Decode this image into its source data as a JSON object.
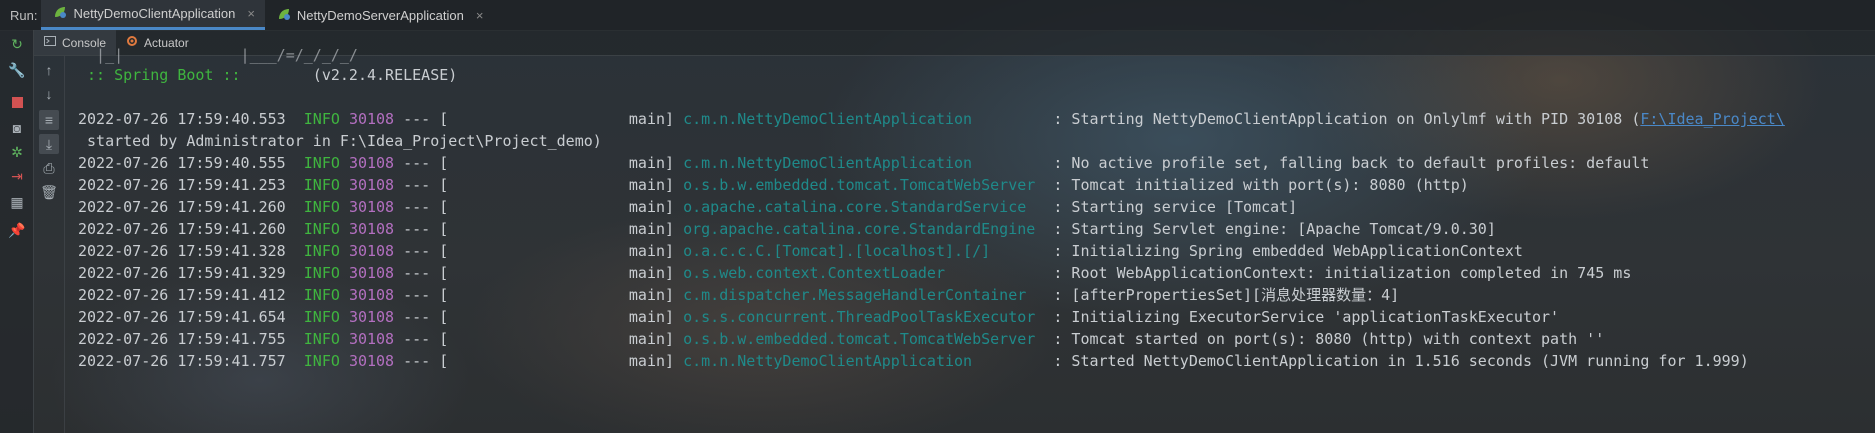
{
  "run_bar": {
    "label": "Run:",
    "tabs": [
      {
        "label": "NettyDemoClientApplication",
        "active": true
      },
      {
        "label": "NettyDemoServerApplication",
        "active": false
      }
    ],
    "close_glyph": "×"
  },
  "sub_tabs": [
    {
      "label": "Console",
      "icon": "console-icon",
      "active": true
    },
    {
      "label": "Actuator",
      "icon": "actuator-icon",
      "active": false
    }
  ],
  "toolbar_icons": {
    "left": [
      "rerun-icon",
      "settings-wrench-icon",
      "stop-icon",
      "camera-icon",
      "debug-icon",
      "exit-icon",
      "layout-icon",
      "pin-icon"
    ],
    "right": [
      "arrow-up-icon",
      "arrow-down-icon",
      "soft-wrap-icon",
      "scroll-to-end-icon",
      "print-icon",
      "trash-icon"
    ]
  },
  "colors": {
    "info": "#3fb53f",
    "pid": "#b36fc0",
    "logger": "#1f8a8a",
    "link": "#4a88c7",
    "text": "#c9cdd1"
  },
  "console": {
    "banner_cut": "  |_|             |___/=/_/_/_/",
    "spring_label": " :: Spring Boot ::",
    "spring_version": "        (v2.2.4.RELEASE)",
    "started_pid_msg": ": Starting NettyDemoClientApplication on Onlylmf with PID 30108 (",
    "started_link": "F:\\Idea_Project\\",
    "continuation": " started by Administrator in F:\\Idea_Project\\Project_demo)",
    "logs": [
      {
        "ts": "2022-07-26 17:59:40.553",
        "level": "INFO",
        "pid": "30108",
        "sep": "--- [",
        "thread": "main]",
        "logger": "c.m.n.NettyDemoClientApplication",
        "msg": ": Starting NettyDemoClientApplication on Onlylmf with PID 30108 (",
        "link": "F:\\Idea_Project\\"
      },
      {
        "ts": "2022-07-26 17:59:40.555",
        "level": "INFO",
        "pid": "30108",
        "sep": "--- [",
        "thread": "main]",
        "logger": "c.m.n.NettyDemoClientApplication",
        "msg": ": No active profile set, falling back to default profiles: default"
      },
      {
        "ts": "2022-07-26 17:59:41.253",
        "level": "INFO",
        "pid": "30108",
        "sep": "--- [",
        "thread": "main]",
        "logger": "o.s.b.w.embedded.tomcat.TomcatWebServer",
        "msg": ": Tomcat initialized with port(s): 8080 (http)"
      },
      {
        "ts": "2022-07-26 17:59:41.260",
        "level": "INFO",
        "pid": "30108",
        "sep": "--- [",
        "thread": "main]",
        "logger": "o.apache.catalina.core.StandardService",
        "msg": ": Starting service [Tomcat]"
      },
      {
        "ts": "2022-07-26 17:59:41.260",
        "level": "INFO",
        "pid": "30108",
        "sep": "--- [",
        "thread": "main]",
        "logger": "org.apache.catalina.core.StandardEngine",
        "msg": ": Starting Servlet engine: [Apache Tomcat/9.0.30]"
      },
      {
        "ts": "2022-07-26 17:59:41.328",
        "level": "INFO",
        "pid": "30108",
        "sep": "--- [",
        "thread": "main]",
        "logger": "o.a.c.c.C.[Tomcat].[localhost].[/]",
        "msg": ": Initializing Spring embedded WebApplicationContext"
      },
      {
        "ts": "2022-07-26 17:59:41.329",
        "level": "INFO",
        "pid": "30108",
        "sep": "--- [",
        "thread": "main]",
        "logger": "o.s.web.context.ContextLoader",
        "msg": ": Root WebApplicationContext: initialization completed in 745 ms"
      },
      {
        "ts": "2022-07-26 17:59:41.412",
        "level": "INFO",
        "pid": "30108",
        "sep": "--- [",
        "thread": "main]",
        "logger": "c.m.dispatcher.MessageHandlerContainer",
        "msg": ": [afterPropertiesSet][消息处理器数量：4]"
      },
      {
        "ts": "2022-07-26 17:59:41.654",
        "level": "INFO",
        "pid": "30108",
        "sep": "--- [",
        "thread": "main]",
        "logger": "o.s.s.concurrent.ThreadPoolTaskExecutor",
        "msg": ": Initializing ExecutorService 'applicationTaskExecutor'"
      },
      {
        "ts": "2022-07-26 17:59:41.755",
        "level": "INFO",
        "pid": "30108",
        "sep": "--- [",
        "thread": "main]",
        "logger": "o.s.b.w.embedded.tomcat.TomcatWebServer",
        "msg": ": Tomcat started on port(s): 8080 (http) with context path ''"
      },
      {
        "ts": "2022-07-26 17:59:41.757",
        "level": "INFO",
        "pid": "30108",
        "sep": "--- [",
        "thread": "main]",
        "logger": "c.m.n.NettyDemoClientApplication",
        "msg": ": Started NettyDemoClientApplication in 1.516 seconds (JVM running for 1.999)"
      }
    ]
  }
}
